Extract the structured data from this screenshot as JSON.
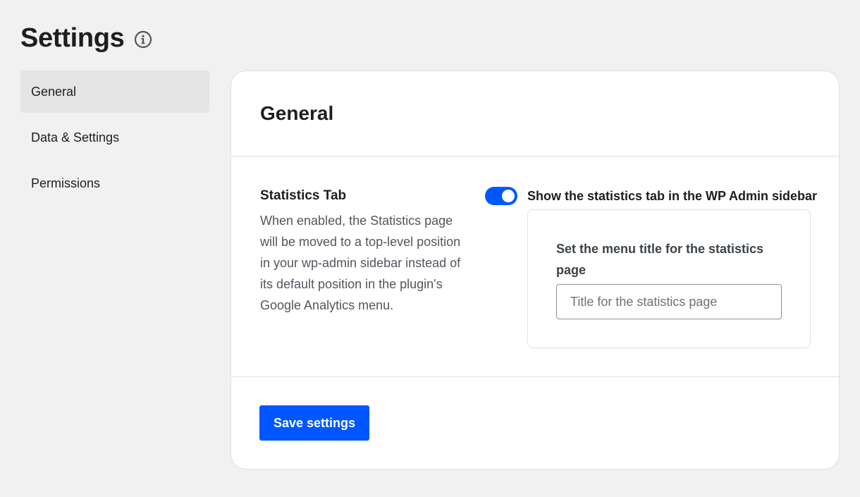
{
  "header": {
    "title": "Settings",
    "info_icon": "info-circle-icon"
  },
  "sidebar": {
    "items": [
      {
        "label": "General",
        "active": true
      },
      {
        "label": "Data & Settings",
        "active": false
      },
      {
        "label": "Permissions",
        "active": false
      }
    ]
  },
  "main": {
    "title": "General",
    "setting": {
      "label": "Statistics Tab",
      "description": "When enabled, the Statistics page will be moved to a top-level position in your wp-admin sidebar instead of its default position in the plugin's Google Analytics menu.",
      "toggle_on": true,
      "toggle_label": "Show the statistics tab in the WP Admin sidebar",
      "menu_title_label": "Set the menu title for the statistics page",
      "menu_title_value": "",
      "menu_title_placeholder": "Title for the statistics page"
    },
    "save_label": "Save settings"
  },
  "colors": {
    "accent": "#0057ff",
    "background": "#f1f1f1",
    "active_nav": "#e4e4e4"
  }
}
